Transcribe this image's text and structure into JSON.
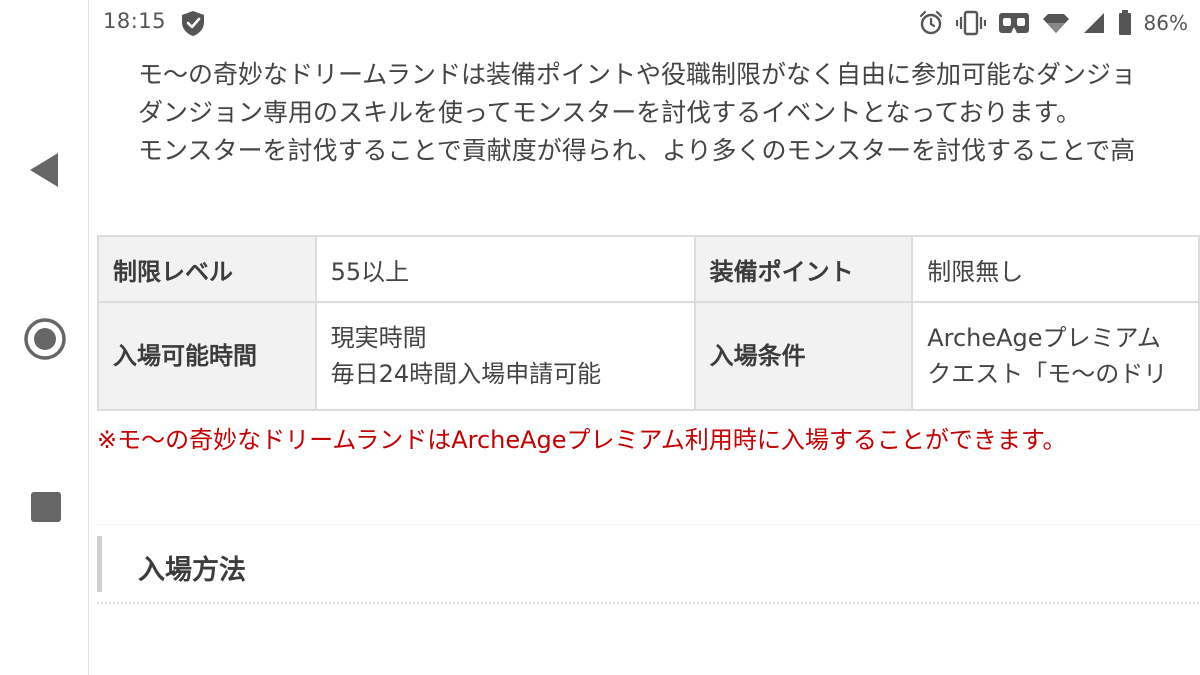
{
  "status_bar": {
    "time": "18:15",
    "battery_percent": "86%",
    "icons": [
      "shield-icon",
      "alarm-icon",
      "vibrate-icon",
      "vr-icon",
      "wifi-icon",
      "cell-signal-icon",
      "battery-icon"
    ]
  },
  "nav_bar": {
    "buttons": [
      "back-icon",
      "home-icon",
      "recents-icon"
    ]
  },
  "intro": {
    "line1": "モ〜の奇妙なドリームランドは装備ポイントや役職制限がなく自由に参加可能なダンジョ",
    "line2": "ダンジョン専用のスキルを使ってモンスターを討伐するイベントとなっております。",
    "line3": "モンスターを討伐することで貢献度が得られ、より多くのモンスターを討伐することで高"
  },
  "table": {
    "rows": [
      {
        "label1": "制限レベル",
        "value1": "55以上",
        "label2": "装備ポイント",
        "value2": "制限無し"
      },
      {
        "label1": "入場可能時間",
        "value1_line1": "現実時間",
        "value1_line2": "毎日24時間入場申請可能",
        "label2": "入場条件",
        "value2_line1": "ArcheAgeプレミアム",
        "value2_line2": "クエスト「モ〜のドリ"
      }
    ]
  },
  "notice": "※モ〜の奇妙なドリームランドはArcheAgeプレミアム利用時に入場することができます。",
  "section": {
    "heading": "入場方法"
  },
  "colors": {
    "notice_red": "#c40000",
    "table_header_bg": "#f2f2f2",
    "table_border": "#dcdcdc",
    "heading_bar": "#cfcfcf"
  }
}
